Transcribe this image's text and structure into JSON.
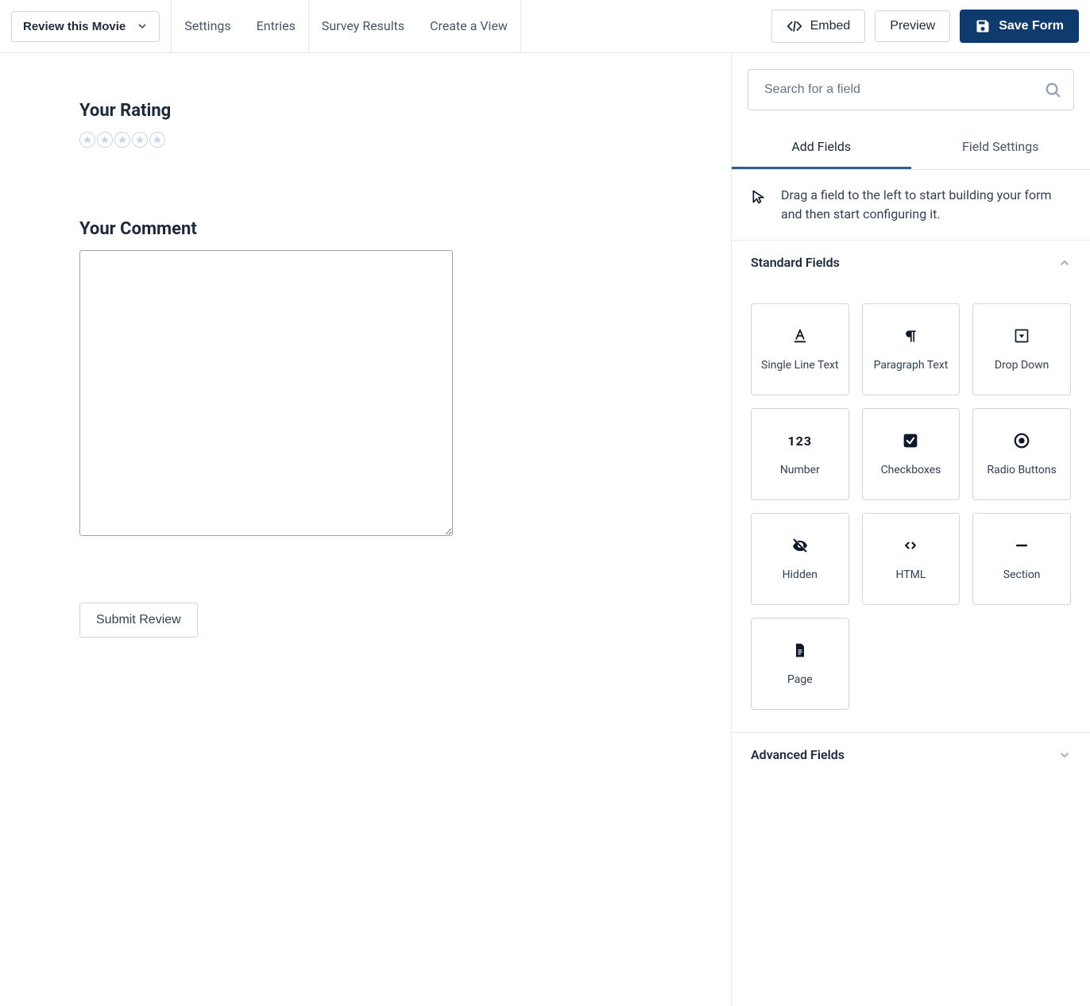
{
  "header": {
    "form_title": "Review this Movie",
    "tabs": {
      "settings": "Settings",
      "entries": "Entries",
      "survey_results": "Survey Results",
      "create_view": "Create a View"
    },
    "actions": {
      "embed": "Embed",
      "preview": "Preview",
      "save": "Save Form"
    }
  },
  "canvas": {
    "rating_label": "Your Rating",
    "comment_label": "Your Comment",
    "submit_label": "Submit Review"
  },
  "sidebar": {
    "search_placeholder": "Search for a field",
    "tabs": {
      "add_fields": "Add Fields",
      "field_settings": "Field Settings"
    },
    "hint": "Drag a field to the left to start building your form and then start configuring it.",
    "sections": {
      "standard": {
        "title": "Standard Fields",
        "fields": {
          "single_line": "Single Line Text",
          "paragraph": "Paragraph Text",
          "dropdown": "Drop Down",
          "number": "Number",
          "checkboxes": "Checkboxes",
          "radio": "Radio Buttons",
          "hidden": "Hidden",
          "html": "HTML",
          "section": "Section",
          "page": "Page"
        }
      },
      "advanced": {
        "title": "Advanced Fields"
      }
    }
  }
}
